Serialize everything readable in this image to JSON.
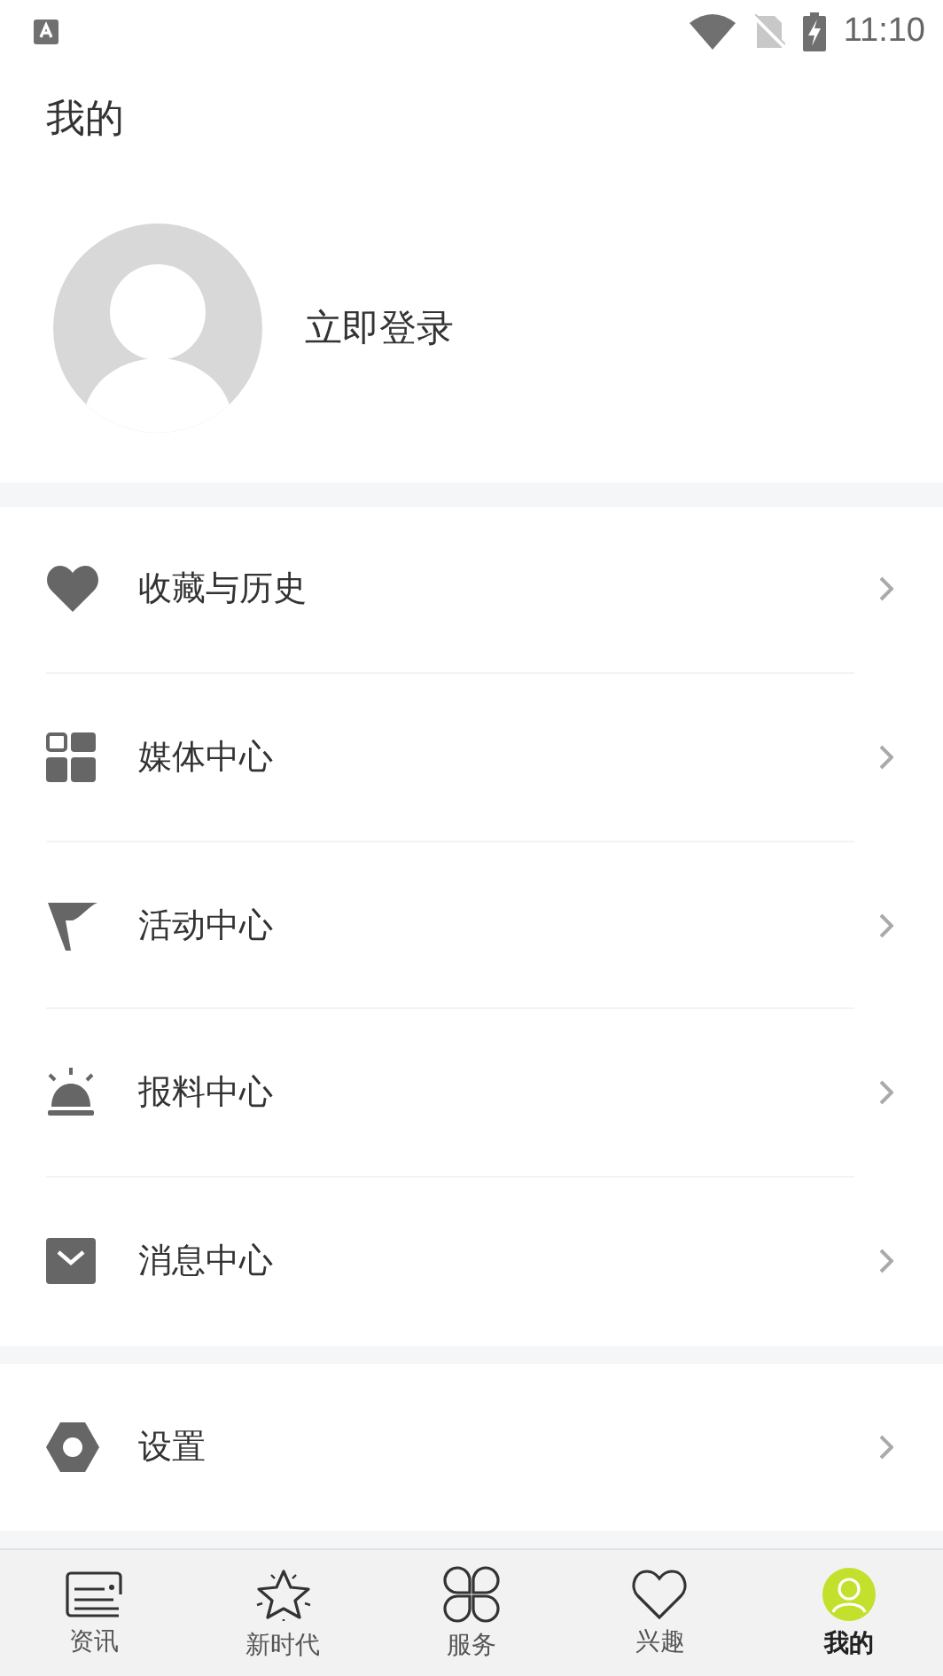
{
  "status_bar": {
    "time": "11:10"
  },
  "header": {
    "title": "我的"
  },
  "profile": {
    "login_label": "立即登录"
  },
  "menu_groups": [
    {
      "items": [
        {
          "label": "收藏与历史",
          "kind": "heart"
        },
        {
          "label": "媒体中心",
          "kind": "grid"
        },
        {
          "label": "活动中心",
          "kind": "flag"
        },
        {
          "label": "报料中心",
          "kind": "alarm"
        },
        {
          "label": "消息中心",
          "kind": "mail"
        }
      ]
    },
    {
      "items": [
        {
          "label": "设置",
          "kind": "settings"
        }
      ]
    }
  ],
  "bottom_nav": [
    {
      "label": "资讯",
      "kind": "news",
      "selected": false
    },
    {
      "label": "新时代",
      "kind": "star",
      "selected": false
    },
    {
      "label": "服务",
      "kind": "clover",
      "selected": false
    },
    {
      "label": "兴趣",
      "kind": "heart",
      "selected": false
    },
    {
      "label": "我的",
      "kind": "user",
      "selected": true
    }
  ]
}
